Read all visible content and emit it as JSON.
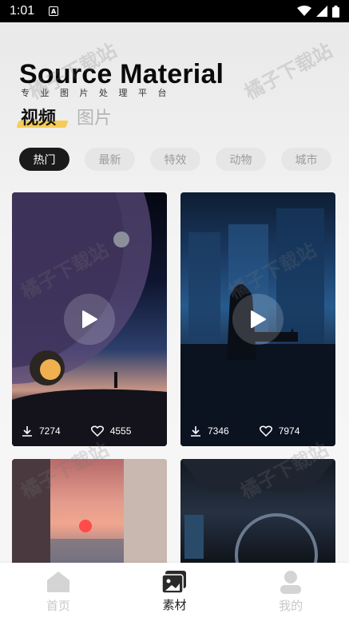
{
  "status": {
    "time": "1:01",
    "a_icon": "A"
  },
  "header": {
    "title": "Source Material",
    "subtitle": "专业图片处理平台"
  },
  "tabs": [
    {
      "label": "视频",
      "active": true
    },
    {
      "label": "图片",
      "active": false
    }
  ],
  "chips": [
    {
      "label": "热门",
      "active": true
    },
    {
      "label": "最新",
      "active": false
    },
    {
      "label": "特效",
      "active": false
    },
    {
      "label": "动物",
      "active": false
    },
    {
      "label": "城市",
      "active": false
    }
  ],
  "cards": [
    {
      "downloads": "7274",
      "likes": "4555"
    },
    {
      "downloads": "7346",
      "likes": "7974"
    },
    {},
    {}
  ],
  "watermark": "橘子下载站",
  "nav": [
    {
      "label": "首页",
      "icon": "home-icon",
      "active": false
    },
    {
      "label": "素材",
      "icon": "material-icon",
      "active": true
    },
    {
      "label": "我的",
      "icon": "profile-icon",
      "active": false
    }
  ],
  "colors": {
    "accent": "#f6cc56",
    "chip_active": "#1b1b1b"
  }
}
